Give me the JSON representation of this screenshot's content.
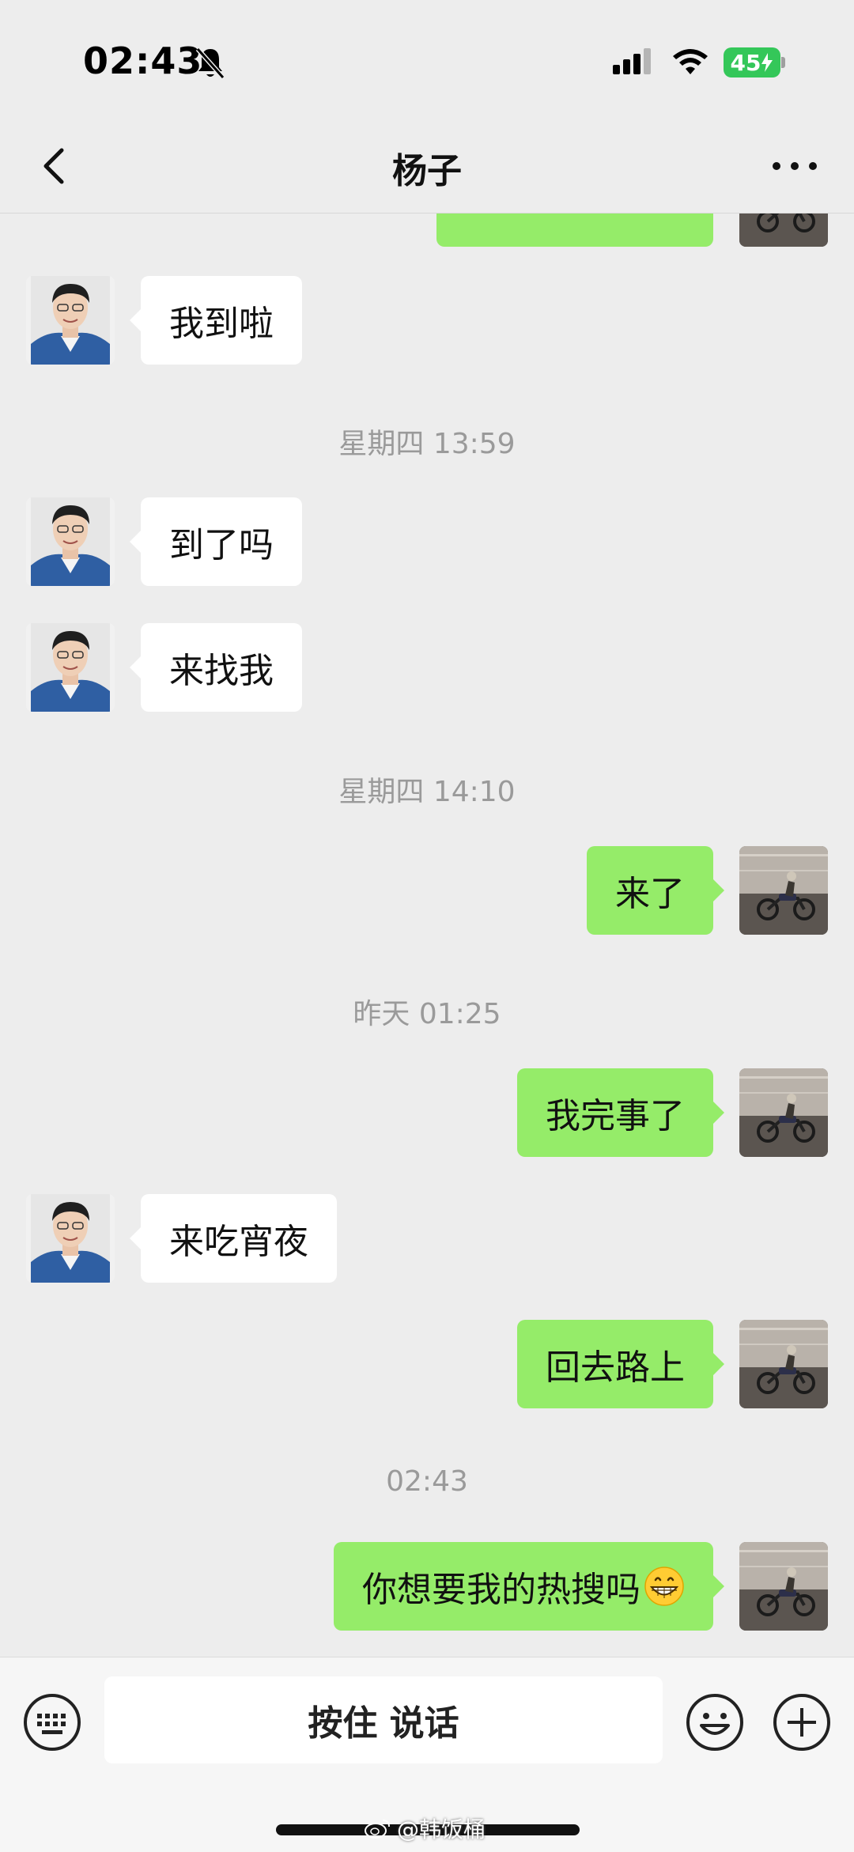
{
  "status_bar": {
    "time": "02:43",
    "battery": "45"
  },
  "header": {
    "title": "杨子"
  },
  "messages": [
    {
      "text": "我到啦"
    },
    {
      "timestamp": "星期四 13:59"
    },
    {
      "text": "到了吗"
    },
    {
      "text": "来找我"
    },
    {
      "timestamp": "星期四 14:10"
    },
    {
      "text": "来了"
    },
    {
      "timestamp": "昨天 01:25"
    },
    {
      "text": "我完事了"
    },
    {
      "text": "来吃宵夜"
    },
    {
      "text": "回去路上"
    },
    {
      "timestamp": "02:43"
    },
    {
      "text": "你想要我的热搜吗"
    }
  ],
  "input_bar": {
    "voice_label": "按住 说话"
  },
  "watermark": "@韩饭桶",
  "colors": {
    "outgoing_bubble": "#95ec69",
    "incoming_bubble": "#ffffff",
    "background": "#ededed",
    "battery": "#34c759"
  }
}
